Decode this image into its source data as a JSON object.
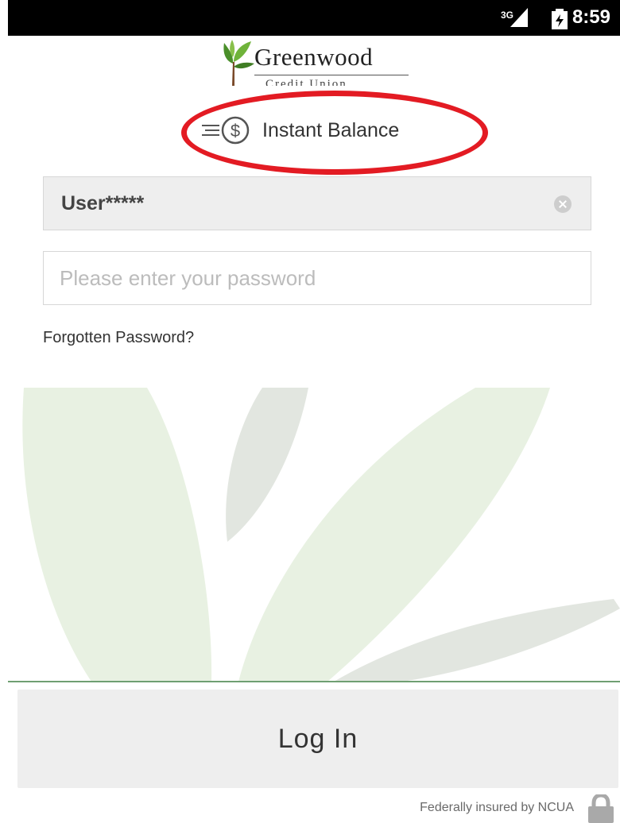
{
  "status_bar": {
    "network": "3G",
    "time": "8:59"
  },
  "logo": {
    "name": "Greenwood",
    "sub": "Credit Union"
  },
  "instant_balance": {
    "label": "Instant Balance",
    "icon": "instant-balance-dollar-icon"
  },
  "login_form": {
    "username_value": "User*****",
    "password_placeholder": "Please enter your password",
    "forgot_label": "Forgotten Password?",
    "submit_label": "Log In"
  },
  "footer": {
    "insured_text": "Federally insured by NCUA",
    "icon": "lock-icon"
  },
  "colors": {
    "annotation_circle": "#e31b23",
    "accent_green": "#6f9f72",
    "field_background": "#eeeeee",
    "status_bar": "#000000"
  }
}
